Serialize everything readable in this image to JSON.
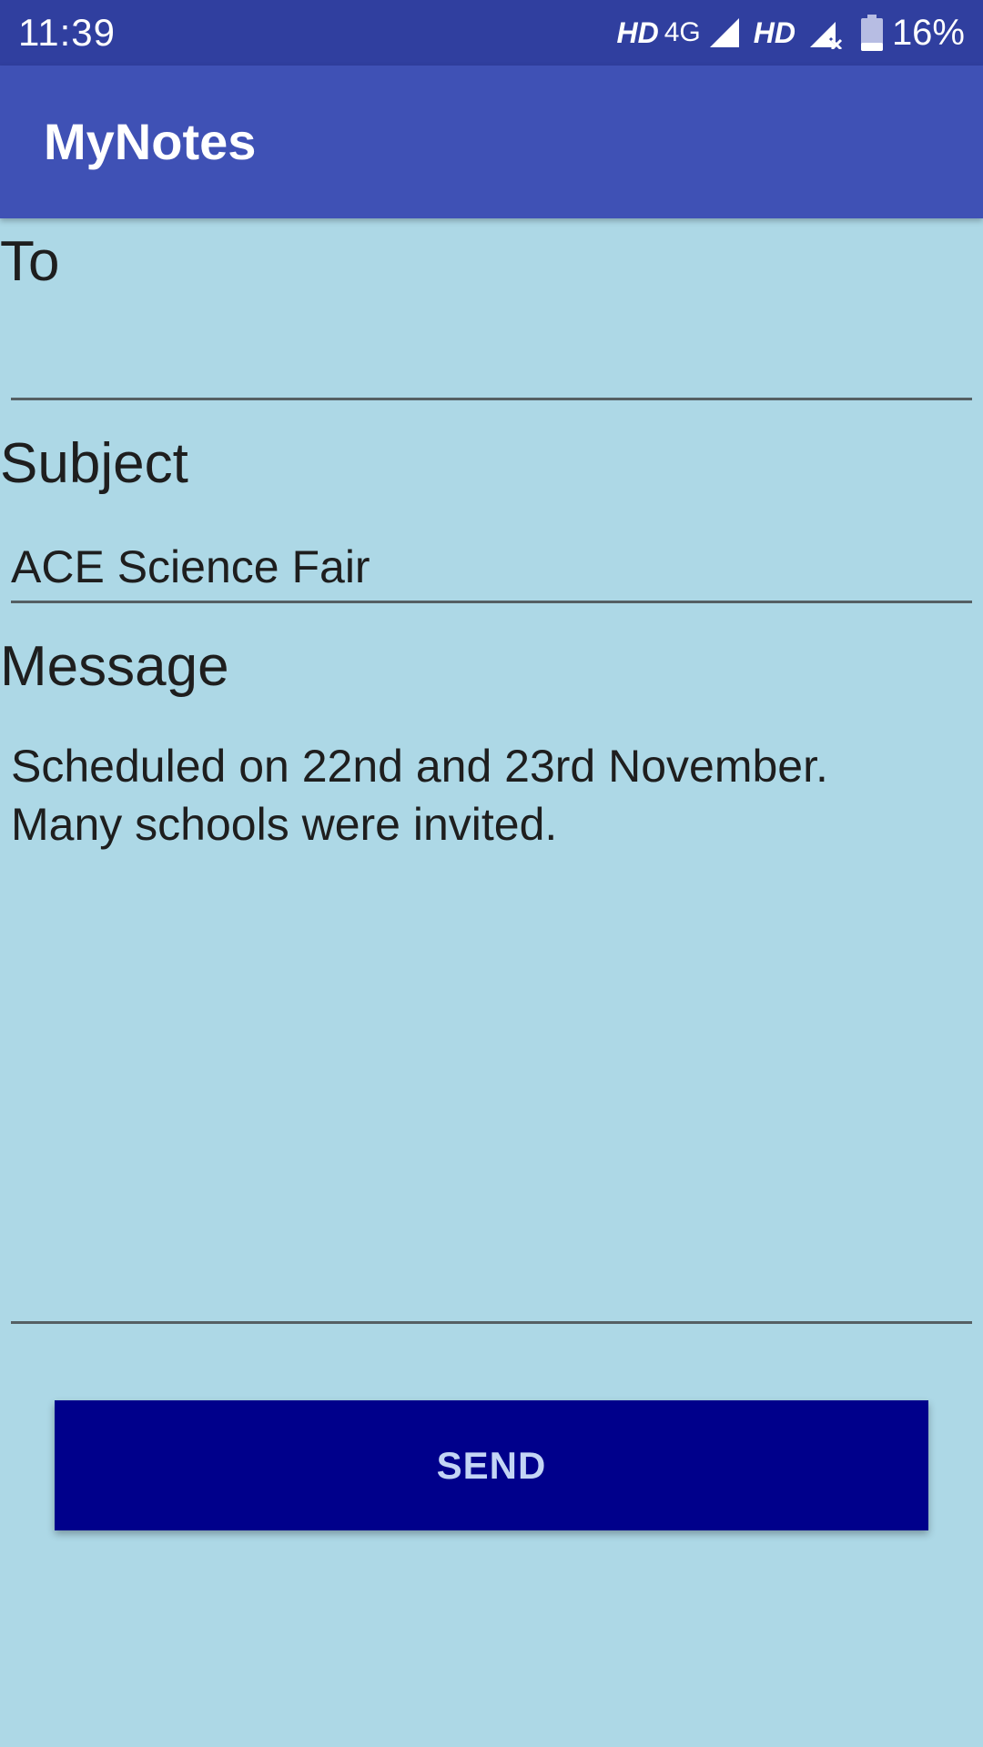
{
  "status_bar": {
    "time": "11:39",
    "hd_label_1": "HD",
    "network_type": "4G",
    "hd_label_2": "HD",
    "battery_percent": "16%",
    "icons": [
      "signal-full-icon",
      "signal-no-service-icon",
      "battery-icon"
    ]
  },
  "app_bar": {
    "title": "MyNotes"
  },
  "form": {
    "to_label": "To",
    "to_value": "",
    "subject_label": "Subject",
    "subject_value": "ACE Science Fair",
    "message_label": "Message",
    "message_lines": [
      "Scheduled on 22nd and 23rd November.",
      "Many schools were invited."
    ],
    "send_label": "SEND"
  },
  "colors": {
    "status_bar": "#303f9f",
    "app_bar": "#3f51b5",
    "background": "#add8e6",
    "send_button": "#00008b",
    "send_text": "#c3d5f5"
  }
}
